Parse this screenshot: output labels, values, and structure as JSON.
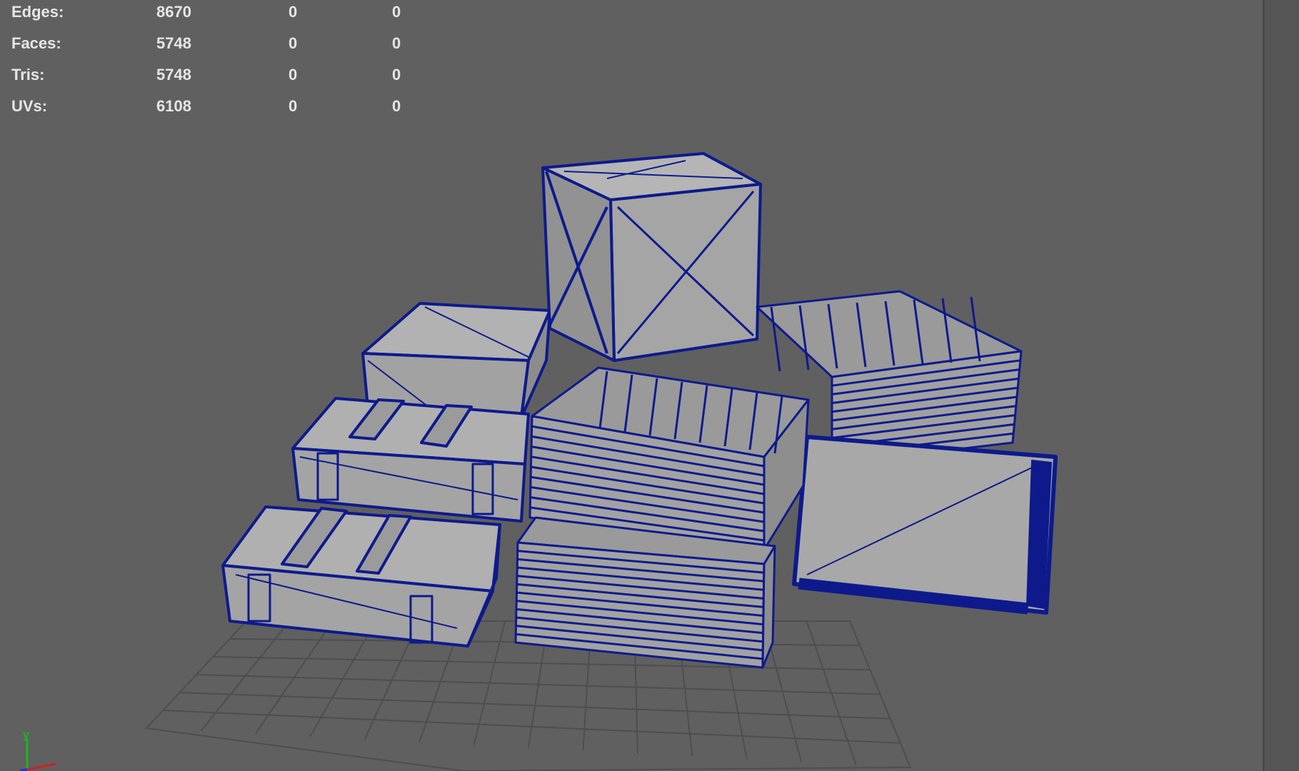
{
  "stats": {
    "rows": [
      {
        "label": "Edges:",
        "v1": "8670",
        "v2": "0",
        "v3": "0"
      },
      {
        "label": "Faces:",
        "v1": "5748",
        "v2": "0",
        "v3": "0"
      },
      {
        "label": "Tris:",
        "v1": "5748",
        "v2": "0",
        "v3": "0"
      },
      {
        "label": "UVs:",
        "v1": "6108",
        "v2": "0",
        "v3": "0"
      }
    ]
  },
  "axis": {
    "y_label": "y"
  },
  "colors": {
    "viewport_bg": "#606060",
    "wire": "#0e1a8c",
    "face": "#a6a6a6",
    "grid": "#4e4e4e",
    "text": "#e6e6e6"
  },
  "icons": [
    "axis-gizmo-icon"
  ]
}
